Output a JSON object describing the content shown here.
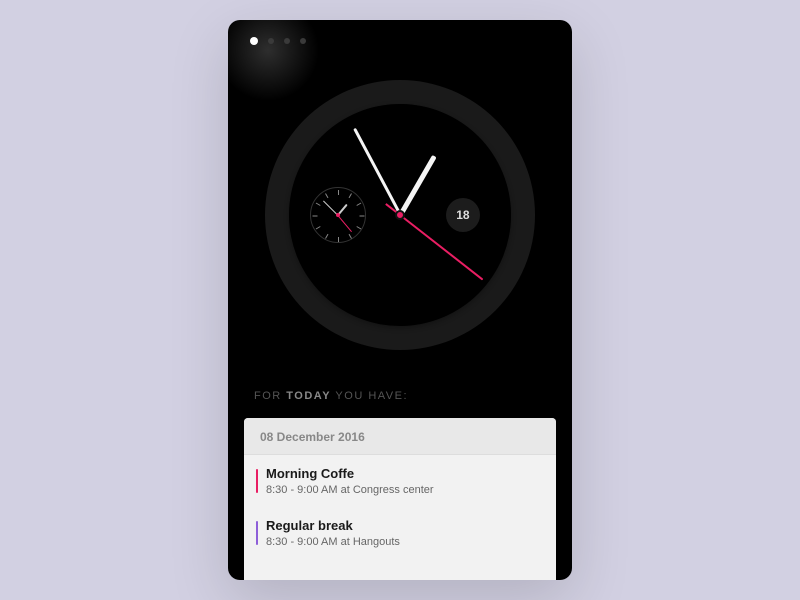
{
  "page_index": 0,
  "page_count": 4,
  "clock": {
    "date_number": "18",
    "hour_angle": 30,
    "minute_angle": -28,
    "second_angle": 128
  },
  "heading": {
    "pre": "FOR ",
    "bold": "TODAY",
    "post": " YOU HAVE:"
  },
  "card": {
    "date": "08 December 2016",
    "events": [
      {
        "title": "Morning Coffe",
        "detail": "8:30 - 9:00 AM at Congress center",
        "color": "#e91e63"
      },
      {
        "title": "Regular break",
        "detail": "8:30 - 9:00 AM at Hangouts",
        "color": "#8e5fd9"
      }
    ]
  }
}
